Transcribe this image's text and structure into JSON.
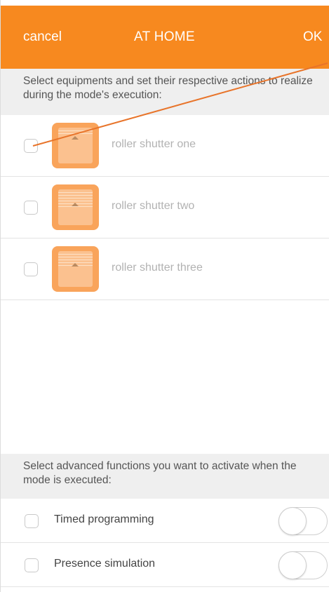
{
  "header": {
    "cancel_label": "cancel",
    "title": "AT HOME",
    "ok_label": "OK",
    "background": "#f7891f"
  },
  "equipment_section": {
    "hint": "Select equipments and set their respective actions to realize during the mode's execution:",
    "items": [
      {
        "label": "roller shutter one",
        "icon": "roller-shutter-icon",
        "checked": false
      },
      {
        "label": "roller shutter two",
        "icon": "roller-shutter-icon",
        "checked": false
      },
      {
        "label": "roller shutter three",
        "icon": "roller-shutter-icon",
        "checked": false
      }
    ]
  },
  "advanced_section": {
    "hint": "Select advanced functions you want to activate when the mode is executed:",
    "items": [
      {
        "label": "Timed programming",
        "checked": false,
        "toggle_on": false
      },
      {
        "label": "Presence simulation",
        "checked": false,
        "toggle_on": false
      }
    ]
  },
  "annotation": {
    "color": "#e8742a"
  }
}
